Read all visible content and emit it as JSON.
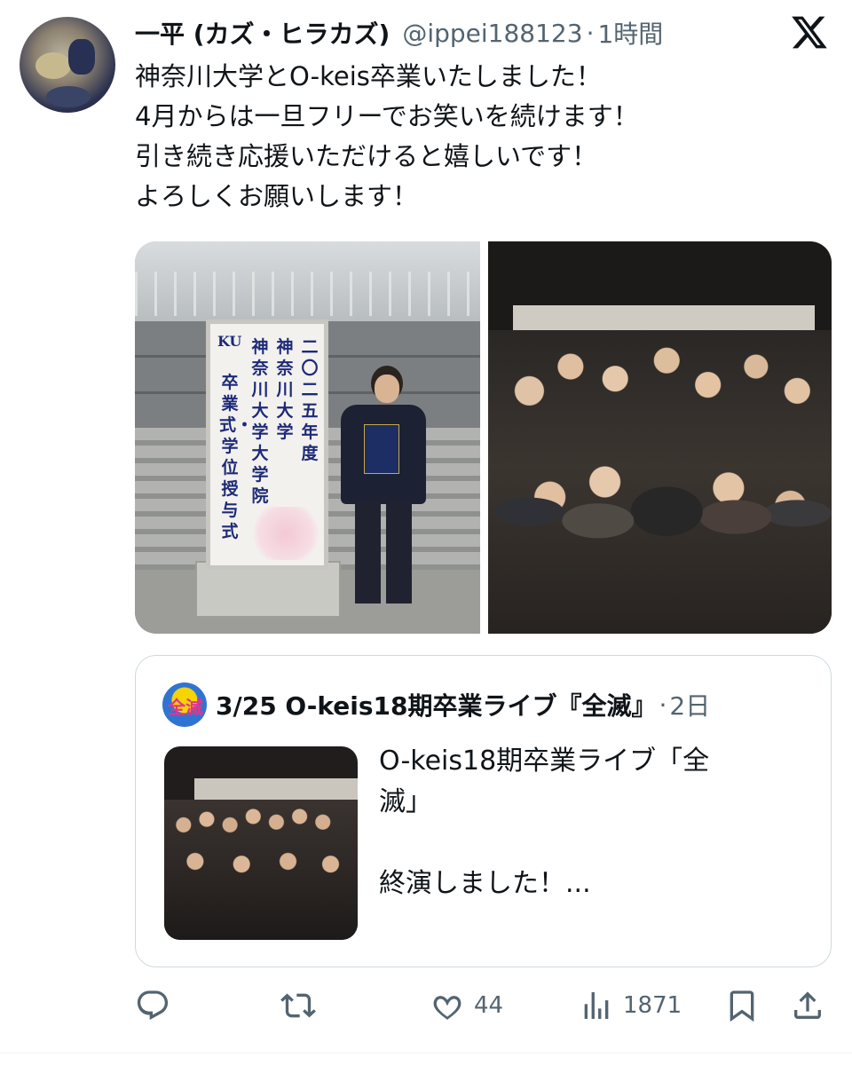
{
  "tweet": {
    "display_name": "一平 (カズ・ヒラカズ)",
    "handle": "@ippei188123",
    "separator": "·",
    "time": "1時間",
    "text_lines": [
      "神奈川大学とO-keis卒業いたしました！",
      "4月からは一旦フリーでお笑いを続けます！",
      "引き続き応援いただけると嬉しいです！",
      "よろしくお願いします！"
    ]
  },
  "media": {
    "left_photo": {
      "sign_columns": [
        "二〇二五年度",
        "神奈川大学",
        "神奈川大学大学院",
        "卒業式・学位授与式"
      ],
      "sign_logo": "KU"
    }
  },
  "quote": {
    "avatar_text": "全滅",
    "name": "3/25 O-keis18期卒業ライブ『全滅』",
    "separator": "·",
    "time": "2日",
    "text_lines": [
      "O-keis18期卒業ライブ「全",
      "滅」",
      "終演しました！..."
    ]
  },
  "actions": {
    "reply_count": "",
    "retweet_count": "",
    "like_count": "44",
    "views_count": "1871"
  },
  "icons": {
    "brand": "x-logo-icon",
    "reply": "reply-icon",
    "retweet": "retweet-icon",
    "like": "heart-icon",
    "views": "views-icon",
    "bookmark": "bookmark-icon",
    "share": "share-icon"
  },
  "colors": {
    "text": "#0f1419",
    "secondary": "#536471",
    "border": "#cfd9de"
  }
}
